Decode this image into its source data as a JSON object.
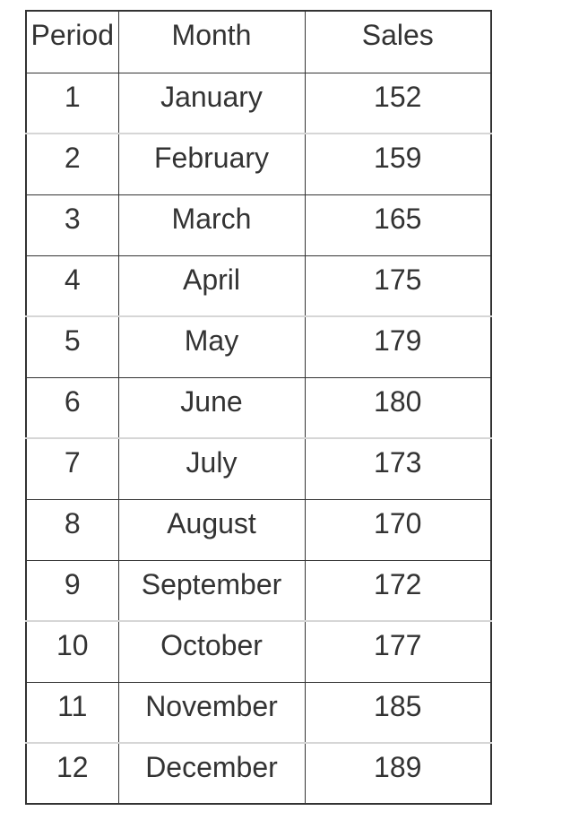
{
  "table": {
    "headers": [
      "Period",
      "Month",
      "Sales"
    ],
    "rows": [
      {
        "period": "1",
        "month": "January",
        "sales": "152"
      },
      {
        "period": "2",
        "month": "February",
        "sales": "159"
      },
      {
        "period": "3",
        "month": "March",
        "sales": "165"
      },
      {
        "period": "4",
        "month": "April",
        "sales": "175"
      },
      {
        "period": "5",
        "month": "May",
        "sales": "179"
      },
      {
        "period": "6",
        "month": "June",
        "sales": "180"
      },
      {
        "period": "7",
        "month": "July",
        "sales": "173"
      },
      {
        "period": "8",
        "month": "August",
        "sales": "170"
      },
      {
        "period": "9",
        "month": "September",
        "sales": "172"
      },
      {
        "period": "10",
        "month": "October",
        "sales": "177"
      },
      {
        "period": "11",
        "month": "November",
        "sales": "185"
      },
      {
        "period": "12",
        "month": "December",
        "sales": "189"
      }
    ]
  },
  "colors": {
    "text": "#333333",
    "border_dark": "#333333",
    "border_light": "#d6d6d6"
  }
}
